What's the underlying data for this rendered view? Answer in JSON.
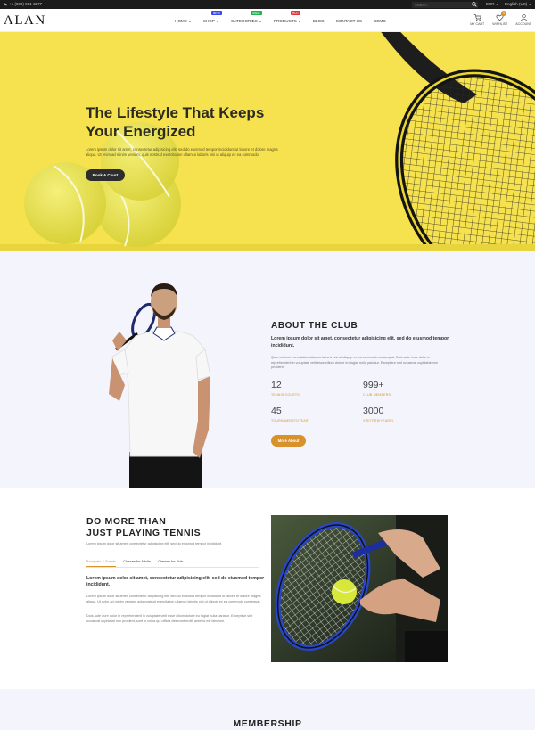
{
  "topbar": {
    "phone": "+1 (600) 691-3277",
    "search_placeholder": "Search...",
    "currency": "EUR",
    "language": "English (US)"
  },
  "header": {
    "logo": "ALAN",
    "nav": [
      {
        "label": "HOME",
        "caret": "⌄"
      },
      {
        "label": "SHOP",
        "caret": "⌄",
        "badge": "NEW",
        "badge_color": "#3a48e8"
      },
      {
        "label": "CATEGORIES",
        "caret": "⌄",
        "badge": "SALE",
        "badge_color": "#22b14c"
      },
      {
        "label": "PRODUCTS",
        "caret": "⌄",
        "badge": "HOT",
        "badge_color": "#e0373a"
      },
      {
        "label": "BLOG"
      },
      {
        "label": "CONTACT US"
      },
      {
        "label": "DEMO"
      }
    ],
    "icons": {
      "cart_label": "MY CART",
      "wishlist_label": "WISHLIST",
      "wishlist_count": "0",
      "account_label": "ACCOUNT"
    }
  },
  "hero": {
    "title_line1": "The Lifestyle That Keeps",
    "title_line2": "Your Energized",
    "text": "Lorem ipsum dolor sit amet, consectetur adipisicing elit, sed do eiusmod tempor incididunt ut labore et dolore magna aliqua. Ut enim ad minim veniam, quis nostrud exercitation ullamco laboris nisi ut aliquip ex ea commodo.",
    "button": "Book A Court"
  },
  "about": {
    "title": "ABOUT THE CLUB",
    "lead": "Lorem ipsum dolor sit amet, consectetur adipisicing elit, sed do eiusmod tempor incididunt.",
    "body": "Quis nostrud exercitation ullamco laboris nisi ut aliquip ex ea commodo consequat. Duis aute irure dolor in reprehenderit in voluptate velit esse cillum dolore eu fugiat nulla pariatur. Excepteur sint occaecat cupidatat non proident.",
    "stats": [
      {
        "num": "12",
        "label": "TENNIS COURTS"
      },
      {
        "num": "999+",
        "label": "CLUB MEMBERS"
      },
      {
        "num": "45",
        "label": "TOURNAMENTS/YEAR"
      },
      {
        "num": "3000",
        "label": "VISITORS/YEARLY"
      }
    ],
    "button": "More About"
  },
  "more": {
    "title_line1": "DO MORE THAN",
    "title_line2": "JUST PLAYING TENNIS",
    "sub": "Lorem ipsum dolor sit amet, consectetur adipisicing elit, sed do eiusmod tempor incididunt.",
    "tabs": [
      "Banquets & Events",
      "Classes for Adults",
      "Classes for Kids"
    ],
    "lead": "Lorem ipsum dolor sit amet, consectetur adipisicing elit, sed do eiusmod tempor incididunt.",
    "p1": "Lorem ipsum dolor sit amet, consectetur adipisicing elit, sed do eiusmod tempor incididunt ut labore et dolore magna aliqua. Ut enim ad minim veniam, quis nostrud exercitation ullamco laboris nisi ut aliquip ex ea commodo consequat.",
    "p2": "Duis aute irure dolor in reprehenderit in voluptate velit esse cillum dolore eu fugiat nulla pariatur. Excepteur sint occaecat cupidatat non proident, sunt in culpa qui officia deserunt mollit anim id est laborum."
  },
  "membership": {
    "title": "MEMBERSHIP"
  },
  "colors": {
    "accent": "#d8912b",
    "hero_bg": "#f5df4a",
    "dark": "#2d2d2d"
  }
}
